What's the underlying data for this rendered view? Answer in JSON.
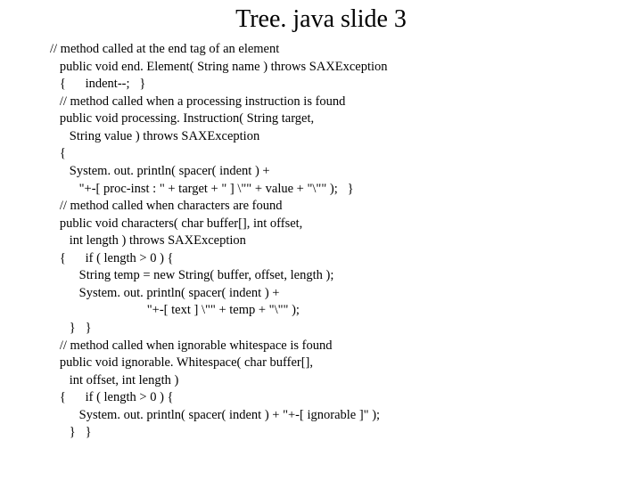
{
  "title": "Tree. java slide 3",
  "code_lines": [
    "// method called at the end tag of an element",
    "   public void end. Element( String name ) throws SAXException",
    "   {      indent--;   }",
    "   // method called when a processing instruction is found",
    "   public void processing. Instruction( String target,",
    "      String value ) throws SAXException",
    "   {",
    "      System. out. println( spacer( indent ) +",
    "         \"+-[ proc-inst : \" + target + \" ] \\\"\" + value + \"\\\"\" );   }",
    "   // method called when characters are found",
    "   public void characters( char buffer[], int offset,",
    "      int length ) throws SAXException",
    "   {      if ( length > 0 ) {",
    "         String temp = new String( buffer, offset, length );",
    "         System. out. println( spacer( indent ) +",
    "                              \"+-[ text ] \\\"\" + temp + \"\\\"\" );",
    "      }   }",
    "   // method called when ignorable whitespace is found",
    "   public void ignorable. Whitespace( char buffer[],",
    "      int offset, int length )",
    "   {      if ( length > 0 ) {",
    "         System. out. println( spacer( indent ) + \"+-[ ignorable ]\" );",
    "      }   }"
  ]
}
